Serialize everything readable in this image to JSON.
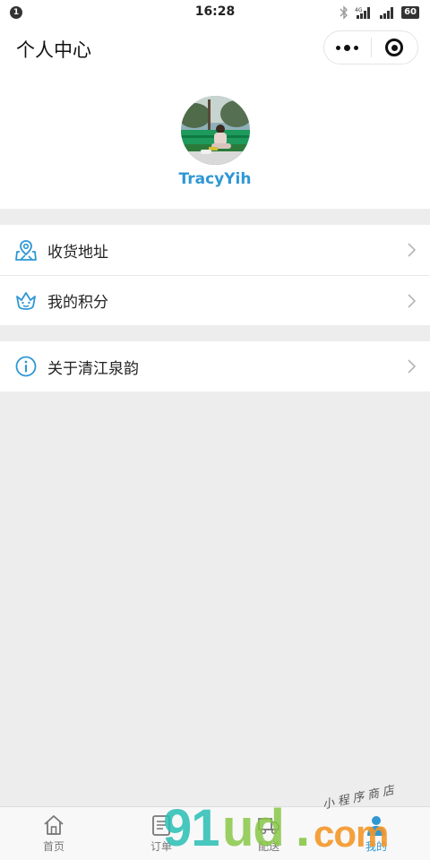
{
  "status_bar": {
    "notification_count": "1",
    "time": "16:28",
    "network_label": "4G",
    "battery": "60"
  },
  "nav": {
    "title": "个人中心",
    "capsule_more_icon": "more-dots-icon",
    "capsule_close_icon": "target-icon"
  },
  "profile": {
    "username": "TracyYih"
  },
  "menu": {
    "group1": [
      {
        "label": "收货地址",
        "icon": "location-map-icon"
      },
      {
        "label": "我的积分",
        "icon": "crown-face-icon"
      }
    ],
    "group2": [
      {
        "label": "关于清江泉韵",
        "icon": "info-icon"
      }
    ]
  },
  "tabs": [
    {
      "label": "首页",
      "icon": "home-icon",
      "active": false
    },
    {
      "label": "订单",
      "icon": "order-list-icon",
      "active": false
    },
    {
      "label": "配送",
      "icon": "delivery-truck-icon",
      "active": false
    },
    {
      "label": "我的",
      "icon": "user-icon",
      "active": true
    }
  ],
  "watermark": {
    "script_text": "小程序商店",
    "brand_part1": "91",
    "brand_part2": "ud",
    "brand_dot": ".",
    "brand_part3": "com"
  },
  "colors": {
    "accent": "#2f97d4",
    "page_background": "#ededed"
  }
}
